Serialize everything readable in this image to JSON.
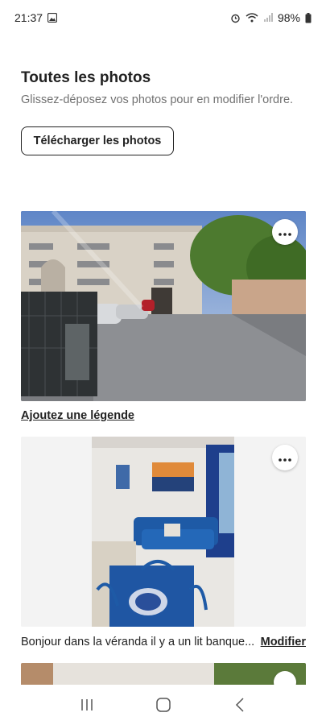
{
  "status_bar": {
    "time": "21:37",
    "battery": "98%",
    "icons": [
      "gallery-icon",
      "alarm-icon",
      "wifi-icon",
      "signal-icon",
      "battery-icon"
    ]
  },
  "header": {
    "title": "Toutes les photos",
    "subtitle": "Glissez-déposez vos photos pour en modifier l'ordre."
  },
  "upload_button": {
    "label": "Télécharger les photos"
  },
  "photos": [
    {
      "caption_link": "Ajoutez une légende",
      "menu_icon": "more-icon"
    },
    {
      "caption": "Bonjour dans la véranda il y a un lit banque...",
      "edit_label": "Modifier",
      "menu_icon": "more-icon"
    }
  ],
  "nav_bar": {
    "icons": [
      "recent-apps-icon",
      "home-icon",
      "back-icon"
    ]
  },
  "colors": {
    "text": "#222222",
    "muted": "#717171",
    "border": "#222222"
  }
}
